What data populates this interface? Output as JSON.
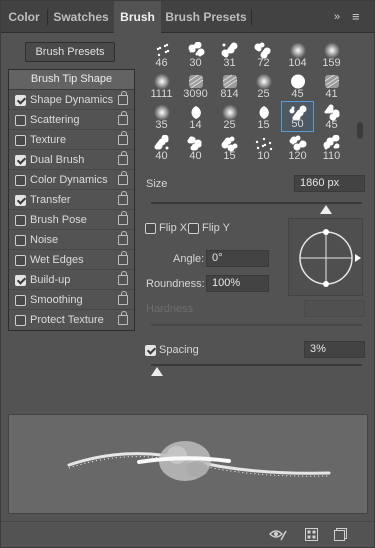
{
  "tabs": [
    {
      "label": "Color",
      "active": false
    },
    {
      "label": "Swatches",
      "active": false
    },
    {
      "label": "Brush",
      "active": true
    },
    {
      "label": "Brush Presets",
      "active": false
    }
  ],
  "tab_menu": {
    "collapse": "»",
    "menu": "≡"
  },
  "presets_button": "Brush Presets",
  "options_header": "Brush Tip Shape",
  "options": [
    {
      "label": "Shape Dynamics",
      "checked": true
    },
    {
      "label": "Scattering",
      "checked": false
    },
    {
      "label": "Texture",
      "checked": false
    },
    {
      "label": "Dual Brush",
      "checked": true
    },
    {
      "label": "Color Dynamics",
      "checked": false
    },
    {
      "label": "Transfer",
      "checked": true
    },
    {
      "label": "Brush Pose",
      "checked": false
    },
    {
      "label": "Noise",
      "checked": false
    },
    {
      "label": "Wet Edges",
      "checked": false
    },
    {
      "label": "Build-up",
      "checked": true
    },
    {
      "label": "Smoothing",
      "checked": false
    },
    {
      "label": "Protect Texture",
      "checked": false
    }
  ],
  "brushes": [
    {
      "size": "46",
      "tip": "dots"
    },
    {
      "size": "30",
      "tip": "splat"
    },
    {
      "size": "31",
      "tip": "splat"
    },
    {
      "size": "72",
      "tip": "splat"
    },
    {
      "size": "104",
      "tip": "soft-round"
    },
    {
      "size": "159",
      "tip": "soft-round"
    },
    {
      "size": "1111",
      "tip": "soft-round"
    },
    {
      "size": "3090",
      "tip": "texture"
    },
    {
      "size": "814",
      "tip": "texture"
    },
    {
      "size": "25",
      "tip": "soft-round"
    },
    {
      "size": "45",
      "tip": "hard-round"
    },
    {
      "size": "41",
      "tip": "texture"
    },
    {
      "size": "35",
      "tip": "soft-round"
    },
    {
      "size": "14",
      "tip": "leaf"
    },
    {
      "size": "25",
      "tip": "soft-round"
    },
    {
      "size": "15",
      "tip": "leaf"
    },
    {
      "size": "50",
      "tip": "splat",
      "selected": true
    },
    {
      "size": "45",
      "tip": "splat"
    },
    {
      "size": "40",
      "tip": "splat"
    },
    {
      "size": "40",
      "tip": "splat"
    },
    {
      "size": "15",
      "tip": "splat"
    },
    {
      "size": "10",
      "tip": "dots"
    },
    {
      "size": "120",
      "tip": "splat"
    },
    {
      "size": "110",
      "tip": "splat"
    }
  ],
  "size": {
    "label": "Size",
    "value": "1860 px",
    "fraction": 0.83
  },
  "flip_x": {
    "label": "Flip X",
    "checked": false
  },
  "flip_y": {
    "label": "Flip Y",
    "checked": false
  },
  "angle": {
    "label": "Angle:",
    "value": "0°"
  },
  "roundness": {
    "label": "Roundness:",
    "value": "100%"
  },
  "hardness": {
    "label": "Hardness",
    "value": ""
  },
  "spacing": {
    "label": "Spacing",
    "checked": true,
    "value": "3%",
    "fraction": 0.03
  },
  "bottom_icons": [
    "eye-brush-icon",
    "grid-icon",
    "new-preset-icon"
  ],
  "colors": {
    "panel": "#535353",
    "tabbar": "#424242",
    "selection": "#5c9ad6",
    "preview": "#686868"
  }
}
